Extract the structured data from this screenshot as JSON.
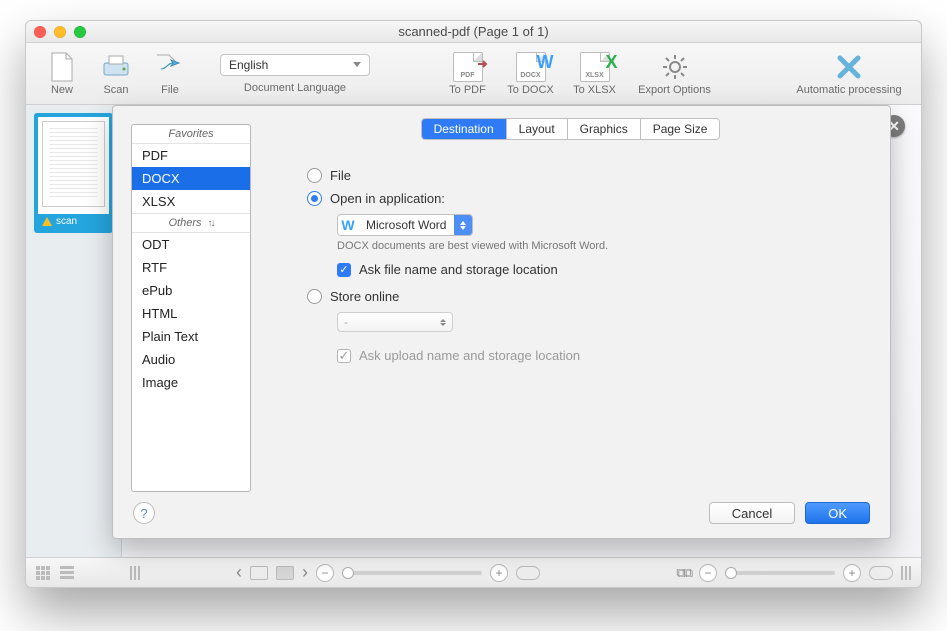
{
  "window": {
    "title": "scanned-pdf (Page 1 of 1)"
  },
  "toolbar": {
    "new": "New",
    "scan": "Scan",
    "file": "File",
    "language_value": "English",
    "language_caption": "Document Language",
    "to_pdf": "To PDF",
    "to_docx": "To DOCX",
    "to_xlsx": "To XLSX",
    "export_options": "Export Options",
    "auto_processing": "Automatic processing"
  },
  "thumbnail": {
    "label": "scan"
  },
  "dialog": {
    "tabs": {
      "destination": "Destination",
      "layout": "Layout",
      "graphics": "Graphics",
      "page_size": "Page Size"
    },
    "favorites_header": "Favorites",
    "others_header": "Others",
    "favorites": {
      "pdf": "PDF",
      "docx": "DOCX",
      "xlsx": "XLSX"
    },
    "others": {
      "odt": "ODT",
      "rtf": "RTF",
      "epub": "ePub",
      "html": "HTML",
      "plain": "Plain Text",
      "audio": "Audio",
      "image": "Image"
    },
    "opt_file": "File",
    "opt_open_app": "Open in application:",
    "app_value": "Microsoft Word",
    "app_hint": "DOCX documents are best viewed with Microsoft Word.",
    "ask_filename": "Ask file name and storage location",
    "opt_store": "Store online",
    "store_value": "-",
    "ask_upload": "Ask upload name and storage location",
    "cancel": "Cancel",
    "ok": "OK",
    "help": "?"
  }
}
